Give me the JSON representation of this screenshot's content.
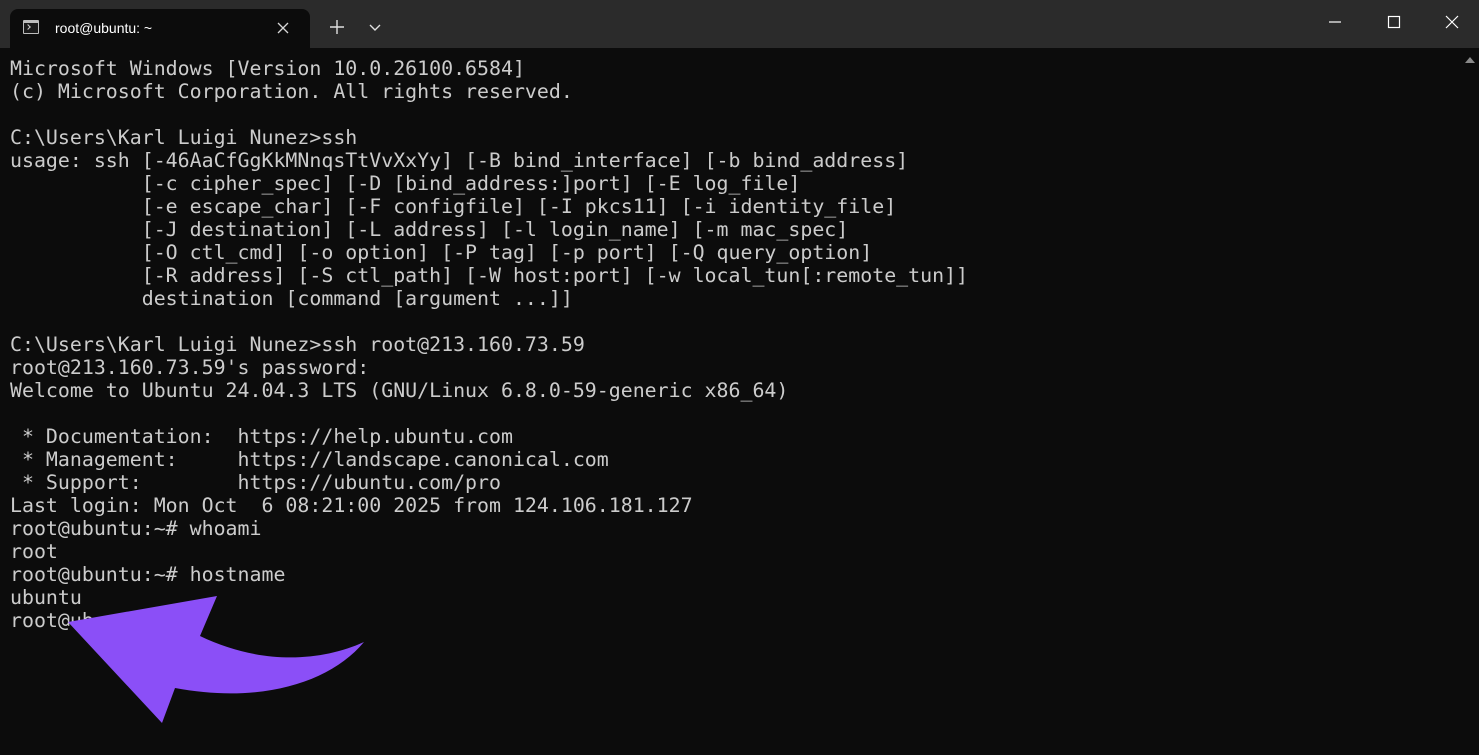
{
  "window": {
    "tab_title": "root@ubuntu: ~",
    "icons": {
      "tab": "terminal-icon",
      "tab_close": "close-icon",
      "new_tab": "plus-icon",
      "dropdown": "chevron-down-icon",
      "minimize": "minimize-icon",
      "maximize": "maximize-icon",
      "close": "close-icon"
    }
  },
  "colors": {
    "background": "#0c0c0c",
    "titlebar": "#2b2b2b",
    "text": "#cccccc",
    "annotation_arrow": "#8b4ff7"
  },
  "terminal": {
    "lines": [
      "Microsoft Windows [Version 10.0.26100.6584]",
      "(c) Microsoft Corporation. All rights reserved.",
      "",
      "C:\\Users\\Karl Luigi Nunez>ssh",
      "usage: ssh [-46AaCfGgKkMNnqsTtVvXxYy] [-B bind_interface] [-b bind_address]",
      "           [-c cipher_spec] [-D [bind_address:]port] [-E log_file]",
      "           [-e escape_char] [-F configfile] [-I pkcs11] [-i identity_file]",
      "           [-J destination] [-L address] [-l login_name] [-m mac_spec]",
      "           [-O ctl_cmd] [-o option] [-P tag] [-p port] [-Q query_option]",
      "           [-R address] [-S ctl_path] [-W host:port] [-w local_tun[:remote_tun]]",
      "           destination [command [argument ...]]",
      "",
      "C:\\Users\\Karl Luigi Nunez>ssh root@213.160.73.59",
      "root@213.160.73.59's password:",
      "Welcome to Ubuntu 24.04.3 LTS (GNU/Linux 6.8.0-59-generic x86_64)",
      "",
      " * Documentation:  https://help.ubuntu.com",
      " * Management:     https://landscape.canonical.com",
      " * Support:        https://ubuntu.com/pro",
      "Last login: Mon Oct  6 08:21:00 2025 from 124.106.181.127",
      "root@ubuntu:~# whoami",
      "root",
      "root@ubuntu:~# hostname",
      "ubuntu",
      "root@ub"
    ]
  }
}
